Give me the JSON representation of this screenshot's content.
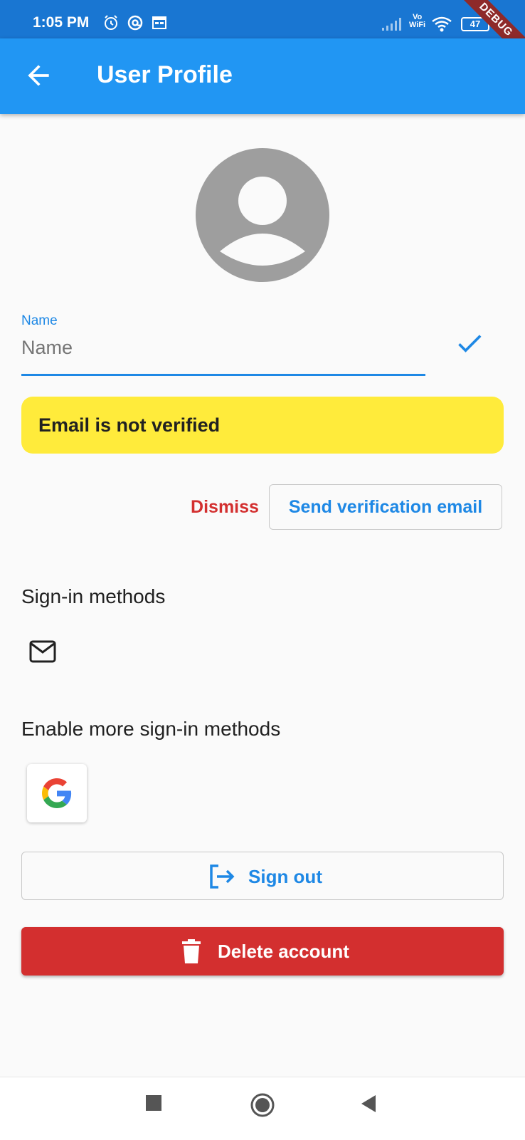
{
  "status_bar": {
    "time": "1:05 PM",
    "battery": "47",
    "icons": [
      "alarm-icon",
      "at-icon",
      "calendar-icon",
      "signal-icon",
      "vowifi-icon",
      "wifi-icon",
      "battery-icon"
    ],
    "vowifi_top": "Vo",
    "vowifi_bottom": "WiFi"
  },
  "debug_banner": "DEBUG",
  "app_bar": {
    "title": "User Profile",
    "back_icon": "arrow-back-icon"
  },
  "profile": {
    "avatar_icon": "account-circle-icon",
    "name_label": "Name",
    "name_placeholder": "Name",
    "name_value": "",
    "confirm_icon": "check-icon"
  },
  "verification": {
    "banner_text": "Email is not verified",
    "dismiss_label": "Dismiss",
    "send_label": "Send verification email"
  },
  "sign_in": {
    "title": "Sign-in methods",
    "methods": [
      "email-icon"
    ],
    "enable_more_title": "Enable more sign-in methods",
    "providers": [
      "google-icon"
    ]
  },
  "actions": {
    "sign_out_label": "Sign out",
    "sign_out_icon": "logout-icon",
    "delete_label": "Delete account",
    "delete_icon": "trash-icon"
  },
  "nav_bar": {
    "buttons": [
      "recents-square-icon",
      "home-circle-icon",
      "back-triangle-icon"
    ]
  },
  "colors": {
    "primary": "#2196f3",
    "status_bar": "#1976d2",
    "accent_text": "#1e88e5",
    "warning": "#ffeb3b",
    "danger": "#d32f2f",
    "background": "#fafafa"
  }
}
